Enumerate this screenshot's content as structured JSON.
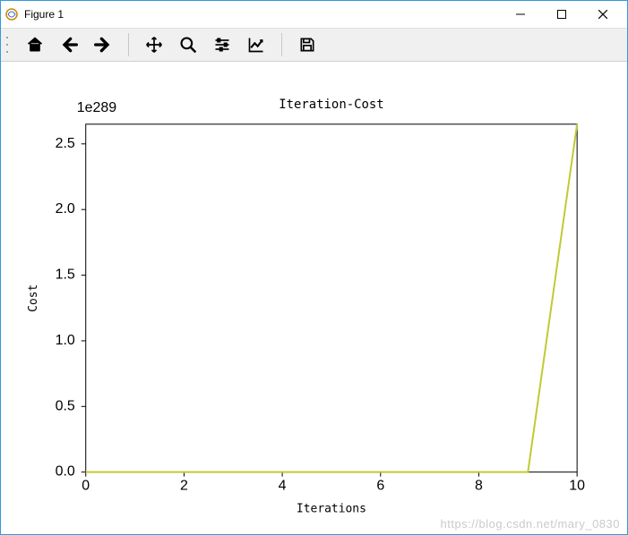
{
  "window": {
    "title": "Figure 1"
  },
  "toolbar": {
    "home_tip": "Reset original view",
    "back_tip": "Back",
    "forward_tip": "Forward",
    "pan_tip": "Pan",
    "zoom_tip": "Zoom",
    "config_tip": "Configure subplots",
    "axes_tip": "Edit axis",
    "save_tip": "Save"
  },
  "watermark": "https://blog.csdn.net/mary_0830",
  "chart_data": {
    "type": "line",
    "title": "Iteration-Cost",
    "xlabel": "Iterations",
    "ylabel": "Cost",
    "y_offset_text": "1e289",
    "xlim": [
      0,
      10
    ],
    "ylim": [
      0.0,
      2.65
    ],
    "x_ticks": [
      0,
      2,
      4,
      6,
      8,
      10
    ],
    "y_ticks": [
      0.0,
      0.5,
      1.0,
      1.5,
      2.0,
      2.5
    ],
    "x": [
      0,
      1,
      2,
      3,
      4,
      5,
      6,
      7,
      8,
      9,
      10
    ],
    "values": [
      0.0,
      0.0,
      0.0,
      0.0,
      0.0,
      0.0,
      0.0,
      0.0,
      0.0,
      0.0,
      2.65
    ],
    "line_color": "#c0ca33"
  }
}
